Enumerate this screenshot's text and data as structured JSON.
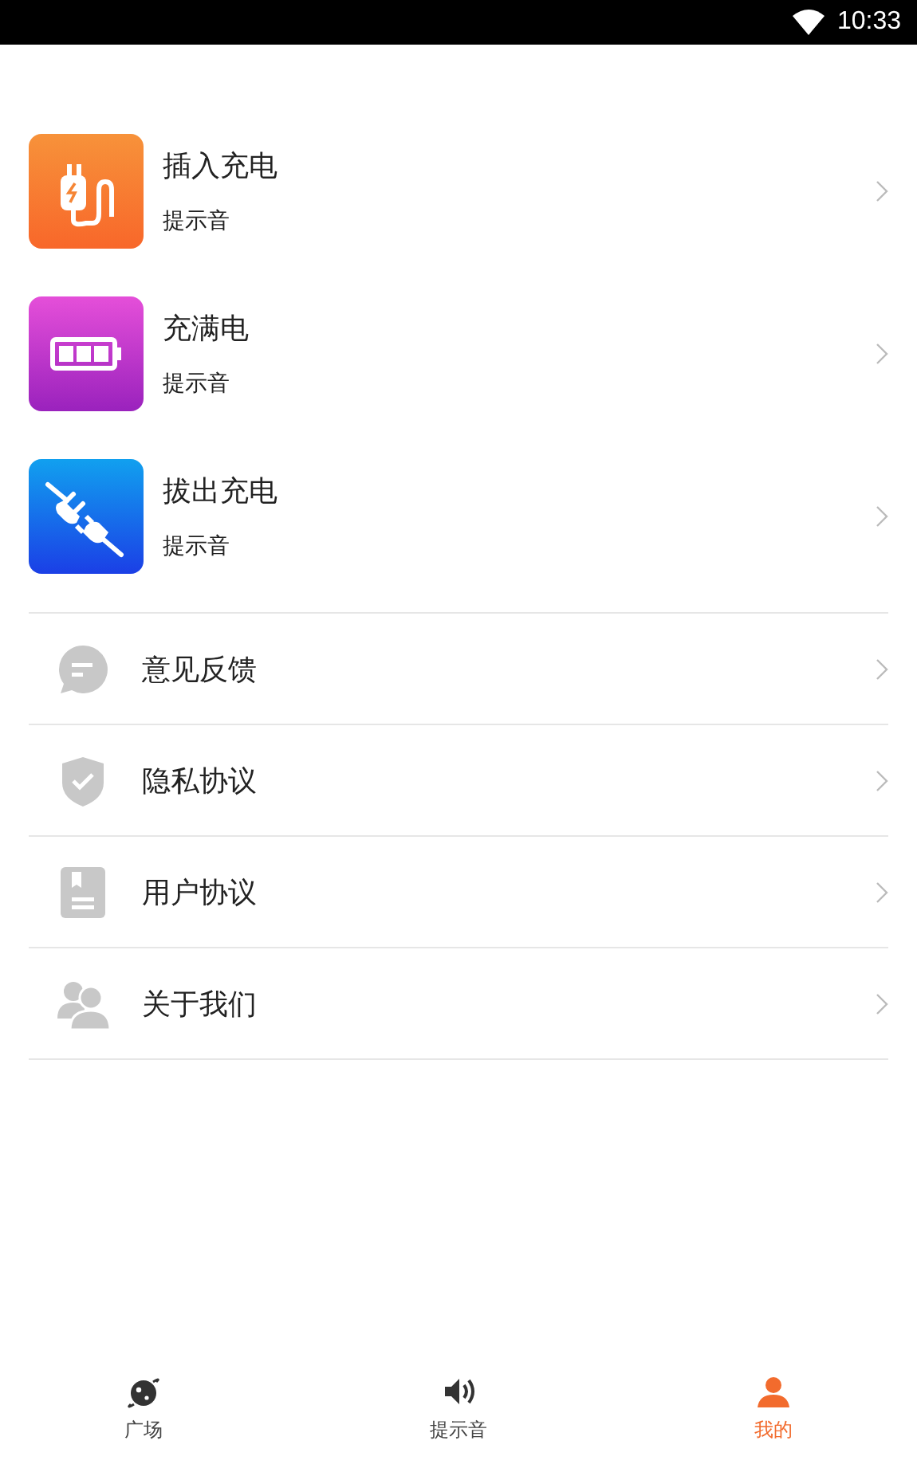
{
  "status_bar": {
    "time": "10:33"
  },
  "sounds": [
    {
      "kind": "plug",
      "title": "插入充电",
      "subtitle": "提示音"
    },
    {
      "kind": "battery",
      "title": "充满电",
      "subtitle": "提示音"
    },
    {
      "kind": "unplug",
      "title": "拔出充电",
      "subtitle": "提示音"
    }
  ],
  "menu": [
    {
      "kind": "feedback",
      "label": "意见反馈"
    },
    {
      "kind": "privacy",
      "label": "隐私协议"
    },
    {
      "kind": "user",
      "label": "用户协议"
    },
    {
      "kind": "about",
      "label": "关于我们"
    }
  ],
  "tabs": [
    {
      "kind": "plaza",
      "label": "广场",
      "selected": false
    },
    {
      "kind": "sound",
      "label": "提示音",
      "selected": false
    },
    {
      "kind": "me",
      "label": "我的",
      "selected": true
    }
  ]
}
